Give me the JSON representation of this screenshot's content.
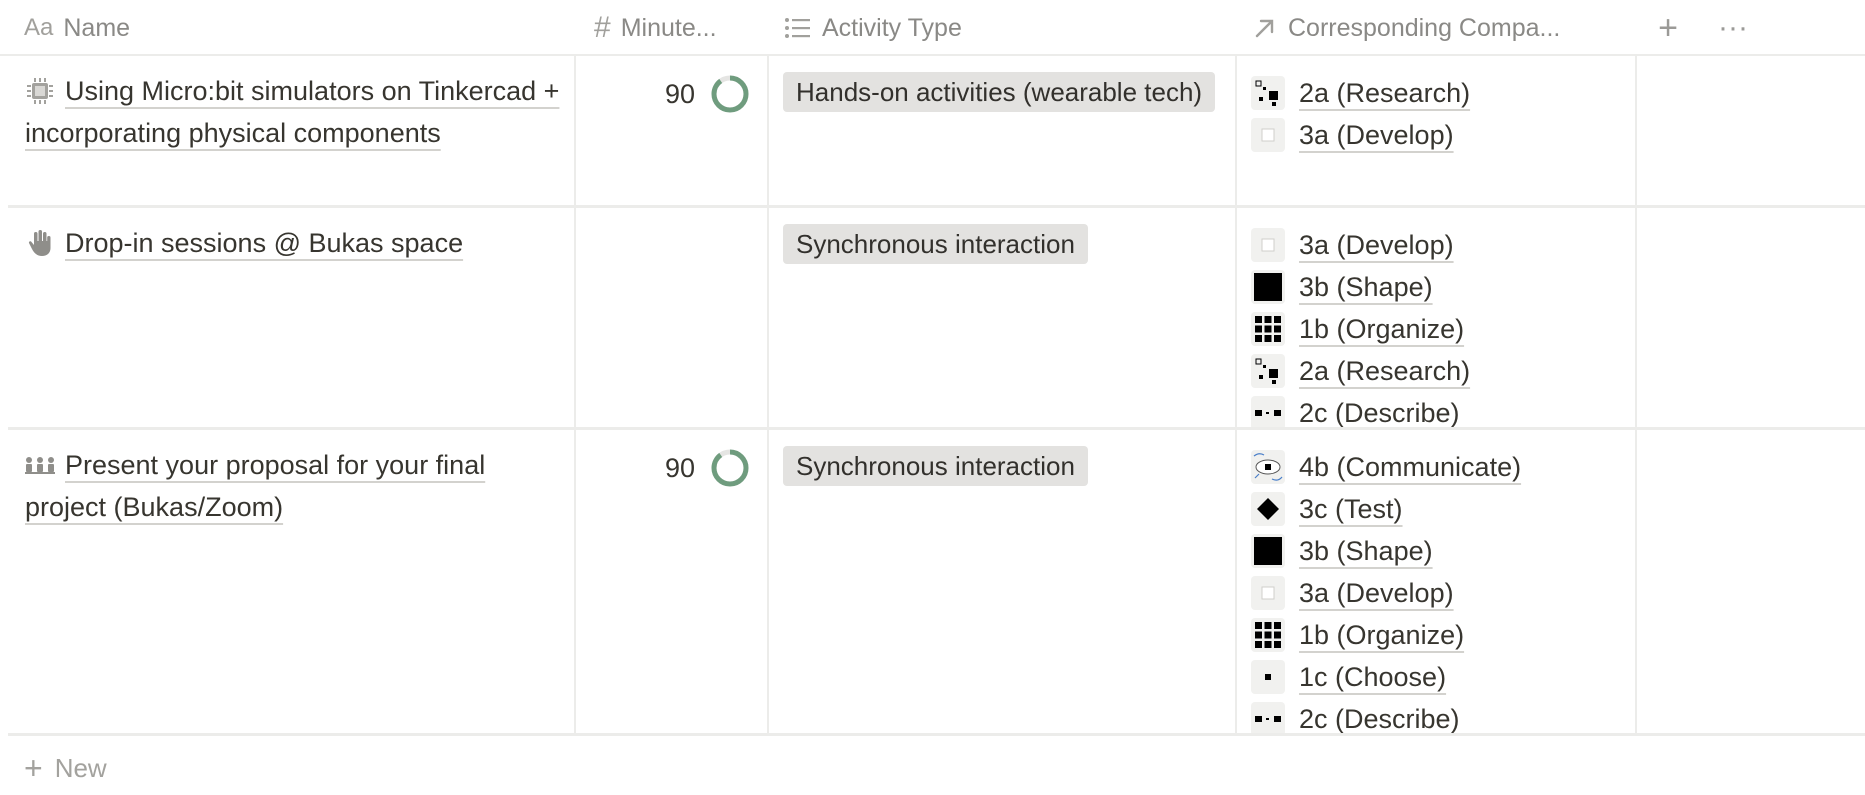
{
  "header": {
    "name": {
      "label": "Name",
      "icon": "text-type-icon",
      "glyph": "Aa"
    },
    "minutes": {
      "label": "Minute...",
      "icon": "number-icon",
      "glyph": "#"
    },
    "activity_type": {
      "label": "Activity Type",
      "icon": "list-icon"
    },
    "companion": {
      "label": "Corresponding Compa...",
      "icon": "relation-arrow-icon"
    },
    "add_glyph": "+",
    "more_glyph": "···"
  },
  "rows": [
    {
      "name": "Using Micro:bit simulators on Tinkercad + incorporating physical components",
      "icon": "microchip-icon",
      "minutes": "90",
      "progress": 0.9,
      "activity_type": "Hands-on activities (wearable tech)",
      "companions": [
        "2a (Research)",
        "3a (Develop)"
      ]
    },
    {
      "name": "Drop-in sessions @ Bukas space",
      "icon": "raised-hand-icon",
      "minutes": "",
      "progress": null,
      "activity_type": "Synchronous interaction",
      "companions": [
        "3a (Develop)",
        "3b (Shape)",
        "1b (Organize)",
        "2a (Research)",
        "2c (Describe)"
      ]
    },
    {
      "name": "Present your proposal for your final project (Bukas/Zoom)",
      "icon": "presentation-audience-icon",
      "minutes": "90",
      "progress": 0.9,
      "activity_type": "Synchronous interaction",
      "companions": [
        "4b (Communicate)",
        "3c (Test)",
        "3b (Shape)",
        "3a (Develop)",
        "1b (Organize)",
        "1c (Choose)",
        "2c (Describe)"
      ]
    }
  ],
  "new_row": {
    "label": "New",
    "glyph": "+"
  },
  "colors": {
    "ring": "#6f9c7e",
    "ring_track": "#e5e5e3",
    "tag_bg": "#e3e2e0",
    "grid": "#ececea"
  }
}
